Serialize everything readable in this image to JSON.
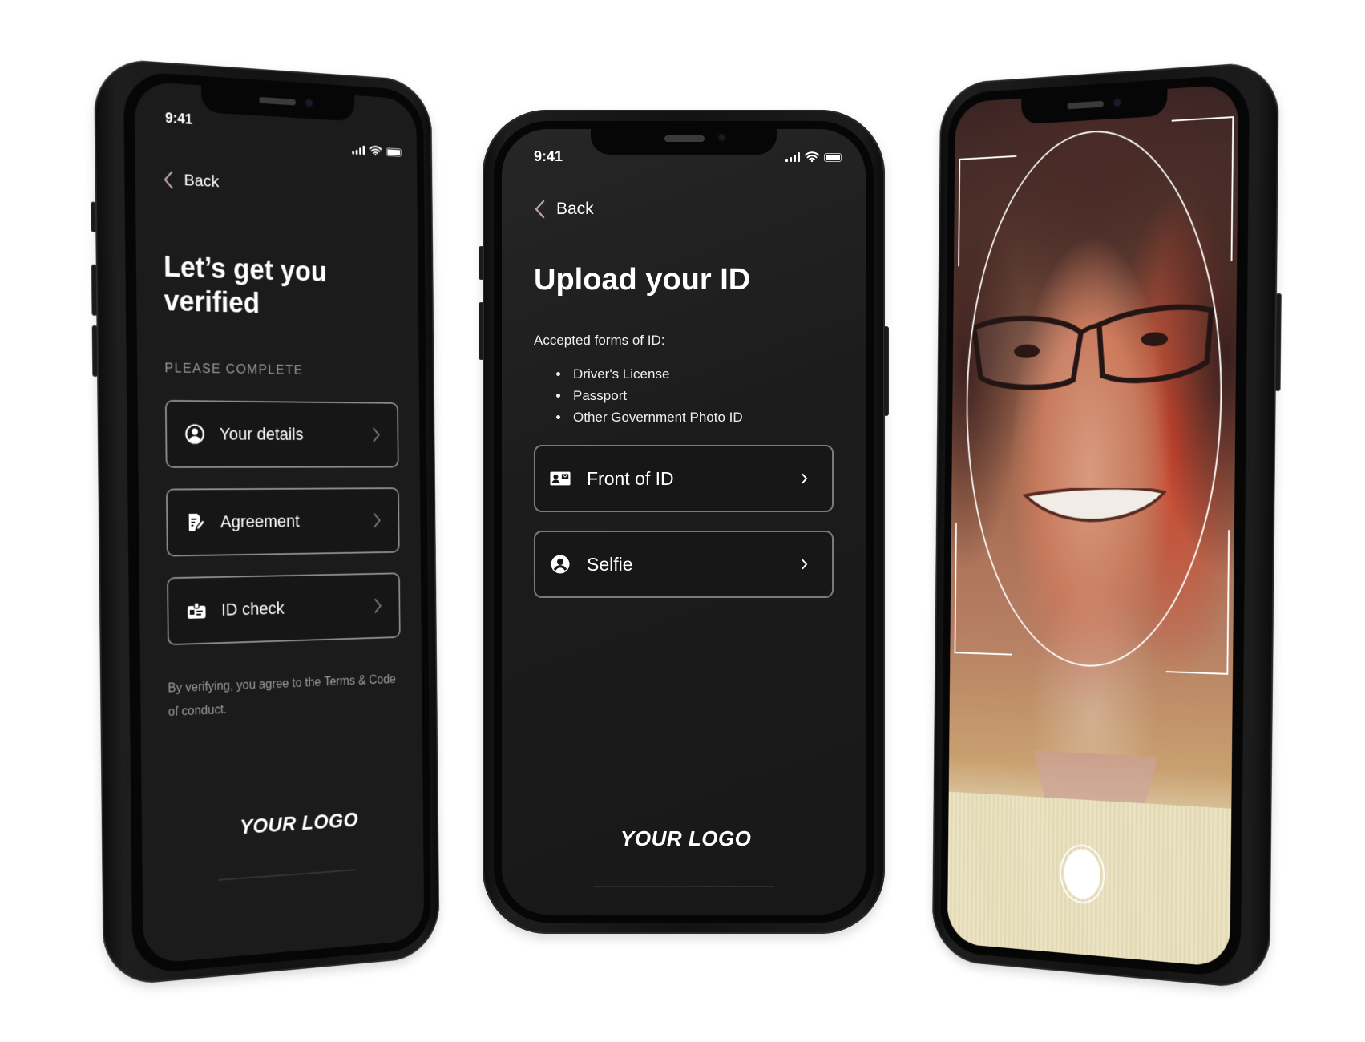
{
  "status_bar": {
    "time": "9:41"
  },
  "phones": {
    "left": {
      "back_label": "Back",
      "title_line1": "Let’s get you",
      "title_line2": "verified",
      "section_label": "PLEASE COMPLETE",
      "items": [
        {
          "label": "Your details",
          "icon": "user-circle-icon"
        },
        {
          "label": "Agreement",
          "icon": "document-edit-icon"
        },
        {
          "label": "ID check",
          "icon": "id-badge-icon"
        }
      ],
      "legal_line1": "By verifying, you agree to the Terms & Code",
      "legal_line2": "of conduct.",
      "logo": "YOUR LOGO"
    },
    "middle": {
      "back_label": "Back",
      "title": "Upload your ID",
      "subtitle": "Accepted forms of ID:",
      "accepted_ids": [
        "Driver's License",
        "Passport",
        "Other Government Photo ID"
      ],
      "items": [
        {
          "label": "Front of ID",
          "icon": "id-card-icon"
        },
        {
          "label": "Selfie",
          "icon": "user-circle-icon"
        }
      ],
      "logo": "YOUR LOGO"
    },
    "right": {
      "mode": "selfie-camera",
      "shutter_icon": "shutter-button-icon"
    }
  },
  "colors": {
    "screen_bg": "#1b1b1b",
    "back_chevron": "#b8a0a0",
    "item_border": "#8a8a8a",
    "muted_text": "#9a9a9a"
  }
}
